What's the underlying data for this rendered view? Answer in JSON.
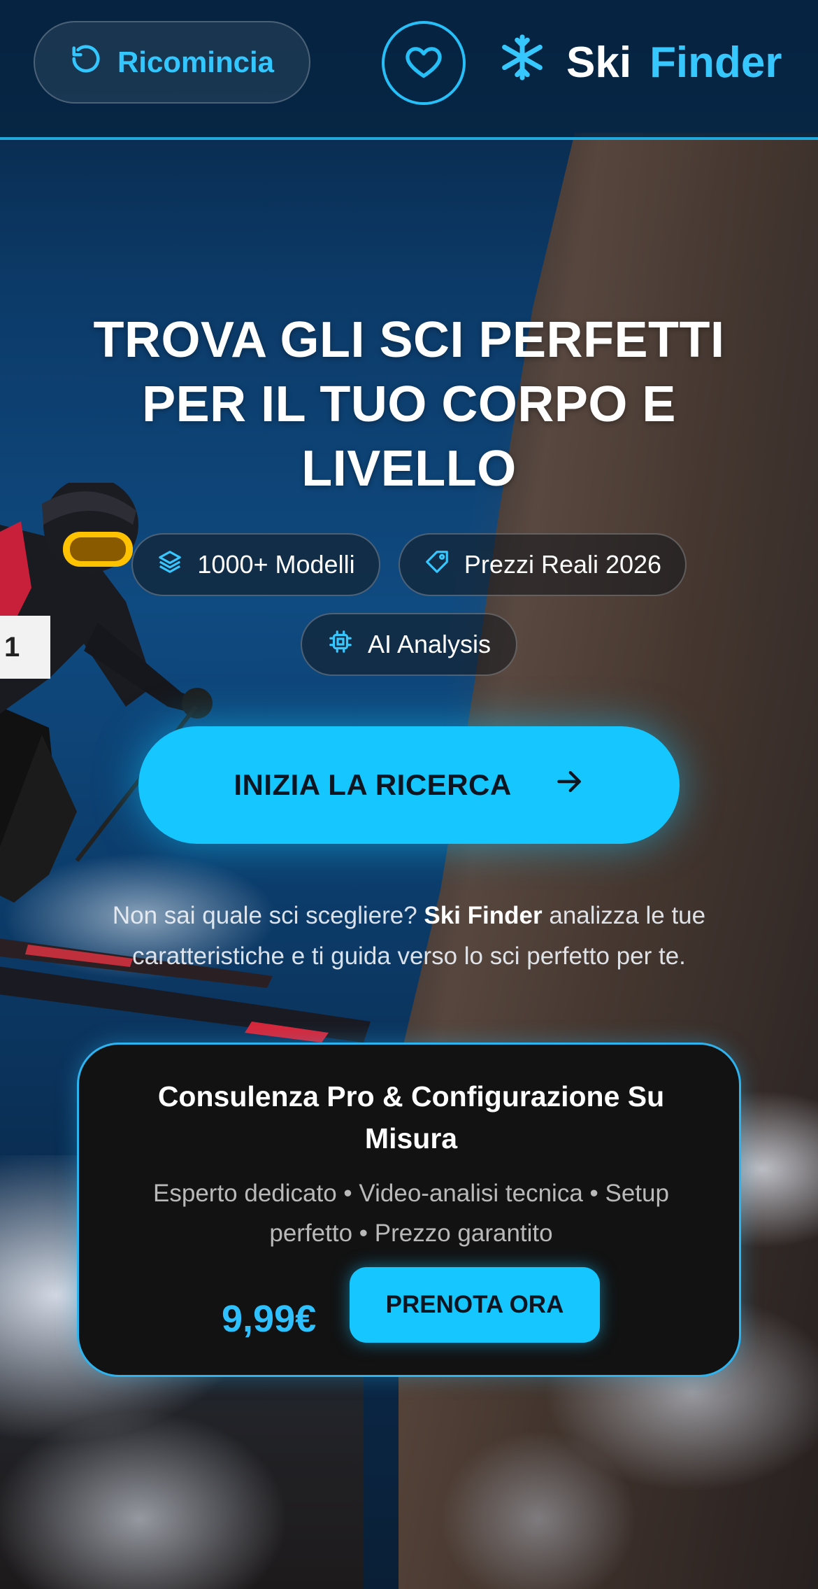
{
  "header": {
    "restart_label": "Ricomincia",
    "restart_icon": "refresh-icon",
    "favorite_icon": "heart-icon",
    "brand_icon": "snowflake-icon",
    "brand_word1": "Ski",
    "brand_word2": "Finder"
  },
  "hero": {
    "title": "TROVA GLI SCI PERFETTI PER IL TUO CORPO E LIVELLO",
    "chips": [
      {
        "label": "1000+ Modelli",
        "icon": "layers-icon"
      },
      {
        "label": "Prezzi Reali 2026",
        "icon": "tag-icon"
      },
      {
        "label": "AI Analysis",
        "icon": "chip-icon"
      }
    ],
    "cta_label": "INIZIA LA RICERCA",
    "cta_icon": "arrow-right-icon",
    "intro_before": "Non sai quale sci scegliere?",
    "intro_brand": "Ski Finder",
    "intro_after": "analizza le tue caratteristiche e ti guida verso lo sci perfetto per te."
  },
  "card": {
    "title": "Consulenza Pro & Configurazione Su Misura",
    "subtitle": "Esperto dedicato • Video-analisi tecnica • Setup perfetto • Prezzo garantito",
    "price": "9,99€",
    "button_label": "PRENOTA ORA"
  },
  "colors": {
    "accent": "#15c6ff",
    "card_bg": "#121212",
    "header_border": "#21a8dc"
  }
}
